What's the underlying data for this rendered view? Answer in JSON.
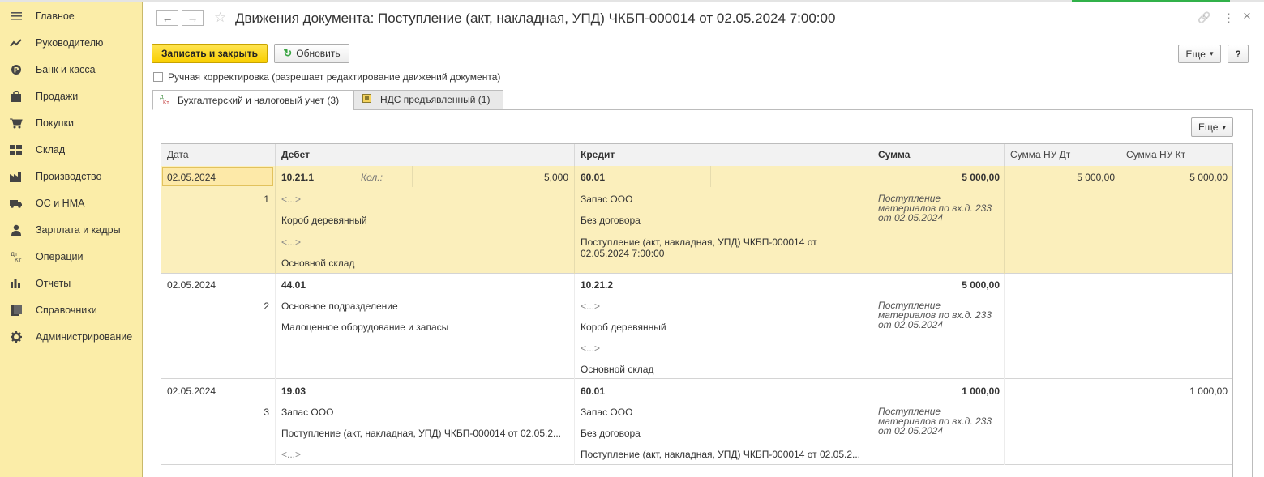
{
  "sidebar": {
    "items": [
      {
        "label": "Главное",
        "icon": "menu-icon"
      },
      {
        "label": "Руководителю",
        "icon": "trend-chart-icon"
      },
      {
        "label": "Банк и касса",
        "icon": "ruble-coin-icon"
      },
      {
        "label": "Продажи",
        "icon": "shopping-bag-icon"
      },
      {
        "label": "Покупки",
        "icon": "cart-icon"
      },
      {
        "label": "Склад",
        "icon": "warehouse-icon"
      },
      {
        "label": "Производство",
        "icon": "factory-icon"
      },
      {
        "label": "ОС и НМА",
        "icon": "truck-icon"
      },
      {
        "label": "Зарплата и кадры",
        "icon": "person-icon"
      },
      {
        "label": "Операции",
        "icon": "dt-kt-icon"
      },
      {
        "label": "Отчеты",
        "icon": "bar-chart-icon"
      },
      {
        "label": "Справочники",
        "icon": "book-icon"
      },
      {
        "label": "Администрирование",
        "icon": "gear-icon"
      }
    ]
  },
  "header": {
    "back_icon": "←",
    "forward_icon": "→",
    "star_icon": "☆",
    "title": "Движения документа: Поступление (акт, накладная, УПД) ЧКБП-000014 от 02.05.2024 7:00:00",
    "link_icon": "🔗",
    "more_icon": "⋮",
    "close_icon": "×"
  },
  "toolbar": {
    "save_close": "Записать и закрыть",
    "refresh": "Обновить",
    "refresh_icon": "↻",
    "more": "Еще",
    "dropdown_icon": "▾",
    "help": "?"
  },
  "manual_correction": {
    "label": "Ручная корректировка (разрешает редактирование движений документа)",
    "checked": false
  },
  "tabs": [
    {
      "label": "Бухгалтерский и налоговый учет (3)",
      "icon": "dt-kt-icon",
      "active": true
    },
    {
      "label": "НДС предъявленный (1)",
      "icon": "register-icon",
      "active": false
    }
  ],
  "grid": {
    "more": "Еще",
    "columns": [
      "Дата",
      "Дебет",
      "Кредит",
      "Сумма",
      "Сумма НУ Дт",
      "Сумма НУ Кт"
    ],
    "rows": [
      {
        "number": "1",
        "date": "02.05.2024",
        "debit": {
          "account": "10.21.1",
          "qty_label": "Кол.:",
          "qty": "5,000",
          "lines": [
            "<...>",
            "Короб деревянный",
            "<...>",
            "Основной склад"
          ]
        },
        "credit": {
          "account": "60.01",
          "lines": [
            "Запас ООО",
            "Без договора",
            "Поступление (акт, накладная, УПД) ЧКБП-000014 от 02.05.2024 7:00:00"
          ]
        },
        "amount": "5 000,00",
        "content": "Поступление материалов по вх.д. 233 от 02.05.2024",
        "nu_dt": "5 000,00",
        "nu_kt": "5 000,00"
      },
      {
        "number": "2",
        "date": "02.05.2024",
        "debit": {
          "account": "44.01",
          "lines": [
            "Основное подразделение",
            "Малоценное оборудование и запасы"
          ]
        },
        "credit": {
          "account": "10.21.2",
          "lines": [
            "<...>",
            "Короб деревянный",
            "<...>",
            "Основной склад"
          ]
        },
        "amount": "5 000,00",
        "content": "Поступление материалов по вх.д. 233 от 02.05.2024",
        "nu_dt": "",
        "nu_kt": ""
      },
      {
        "number": "3",
        "date": "02.05.2024",
        "debit": {
          "account": "19.03",
          "lines": [
            "Запас ООО",
            "Поступление (акт, накладная, УПД) ЧКБП-000014 от 02.05.2...",
            "<...>"
          ]
        },
        "credit": {
          "account": "60.01",
          "lines": [
            "Запас ООО",
            "Без договора",
            "Поступление (акт, накладная, УПД) ЧКБП-000014 от 02.05.2..."
          ]
        },
        "amount": "1 000,00",
        "content": "Поступление материалов по вх.д. 233 от 02.05.2024",
        "nu_dt": "",
        "nu_kt": "1 000,00"
      }
    ]
  }
}
